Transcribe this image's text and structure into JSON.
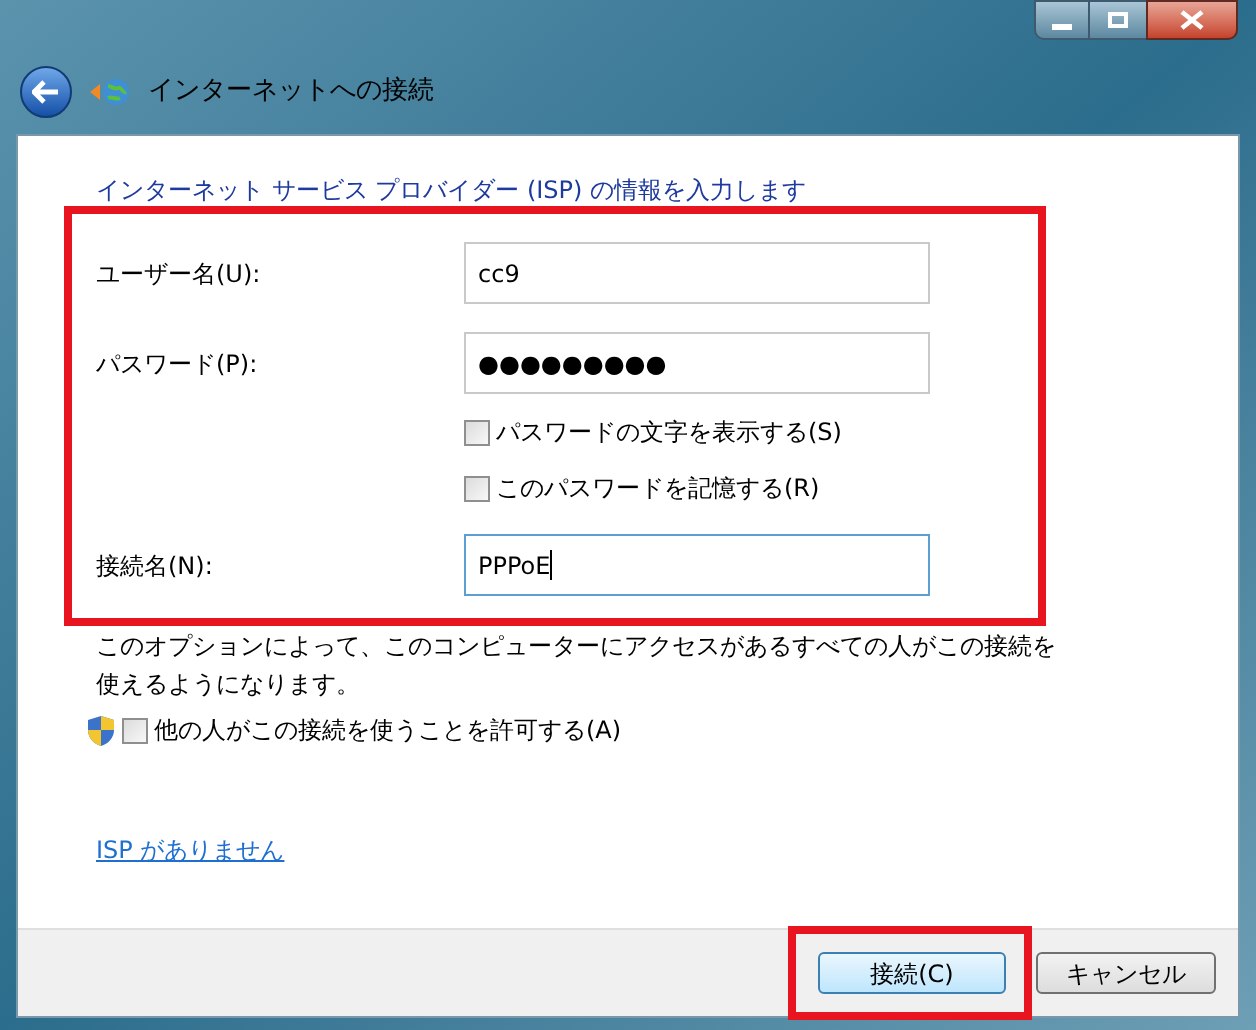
{
  "window": {
    "title": "インターネットへの接続"
  },
  "heading": "インターネット サービス プロバイダー (ISP) の情報を入力します",
  "fields": [
    {
      "label": "ユーザー名(U):",
      "value": "cc9",
      "focused": false
    },
    {
      "label": "パスワード(P):",
      "value": "●●●●●●●●●",
      "focused": false,
      "checkboxes": [
        {
          "label": "パスワードの文字を表示する(S)",
          "checked": false
        },
        {
          "label": "このパスワードを記憶する(R)",
          "checked": false
        }
      ]
    },
    {
      "label": "接続名(N):",
      "value": "PPPoE",
      "focused": true
    }
  ],
  "note": "このオプションによって、このコンピューターにアクセスがあるすべての人がこの接続を使えるようになります。",
  "allow_checkbox": {
    "label": "他の人がこの接続を使うことを許可する(A)",
    "checked": false
  },
  "link": "ISP がありません",
  "buttons": [
    {
      "label": "接続(C)",
      "default": true
    },
    {
      "label": "キャンセル",
      "default": false
    }
  ]
}
